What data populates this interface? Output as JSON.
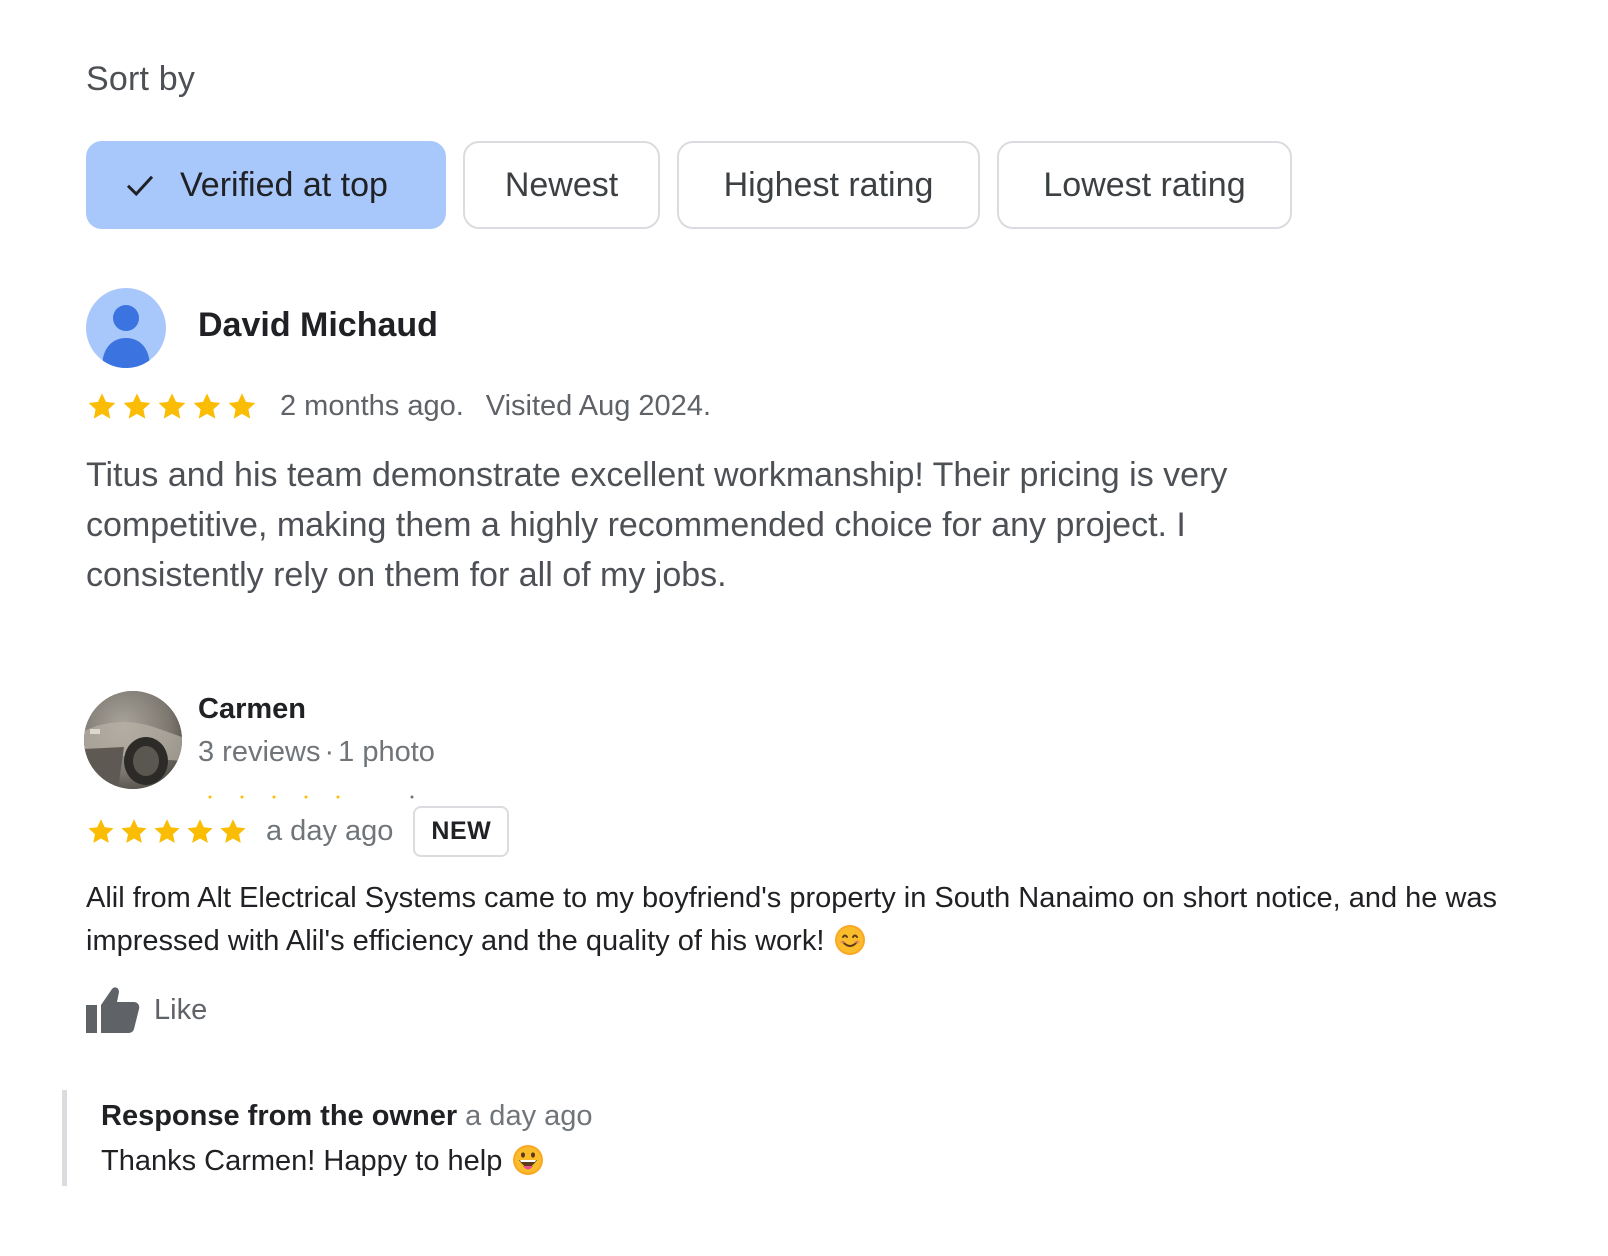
{
  "sort": {
    "label": "Sort by",
    "options": [
      {
        "label": "Verified at top",
        "selected": true
      },
      {
        "label": "Newest",
        "selected": false
      },
      {
        "label": "Highest rating",
        "selected": false
      },
      {
        "label": "Lowest rating",
        "selected": false
      }
    ]
  },
  "reviews": [
    {
      "name": "David Michaud",
      "avatar": "default-person-icon",
      "rating": 5,
      "when": "2 months ago.",
      "visited": "Visited Aug 2024.",
      "text": "Titus and his team demonstrate excellent workmanship! Their pricing is very competitive, making them a highly recommended choice for any project. I consistently rely on them for all of my jobs."
    },
    {
      "name": "Carmen",
      "avatar": "profile-photo",
      "reviews_count": "3 reviews",
      "photos_count": "1 photo",
      "rating": 5,
      "when": "a day ago",
      "badge": "NEW",
      "text": "Alil from Alt Electrical Systems came to my boyfriend's property in South Nanaimo on short notice, and he was impressed with Alil's efficiency and the quality of his work!",
      "text_emoji": "smiling-face-emoji",
      "like_label": "Like",
      "owner_response": {
        "title": "Response from the owner",
        "when": "a day ago",
        "text": "Thanks Carmen! Happy to help",
        "emoji": "grinning-tongue-face-emoji"
      }
    }
  ],
  "colors": {
    "selected_chip": "#a8c7fa",
    "star": "#fbbc04",
    "chip_border": "#dadce0",
    "muted_text": "#70757a"
  }
}
